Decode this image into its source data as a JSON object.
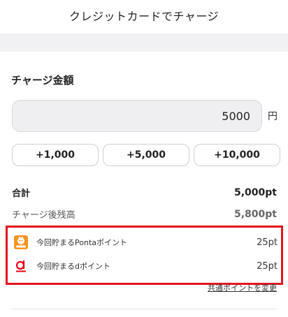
{
  "header": {
    "title": "クレジットカードでチャージ"
  },
  "charge": {
    "section_title": "チャージ金額",
    "amount_value": "5000",
    "unit": "円",
    "quick_buttons": [
      "+1,000",
      "+5,000",
      "+10,000"
    ]
  },
  "summary": {
    "total_label": "合計",
    "total_value": "5,000pt",
    "after_label": "チャージ後残高",
    "after_value": "5,800pt"
  },
  "points": [
    {
      "icon": "ponta-icon",
      "label": "今回貯まるPontaポイント",
      "value": "25pt"
    },
    {
      "icon": "d-point-icon",
      "label": "今回貯まるdポイント",
      "value": "25pt"
    }
  ],
  "links": {
    "change_points": "共通ポイントを変更"
  },
  "colors": {
    "highlight": "#e4141f",
    "ponta": "#f7931e",
    "dpoint": "#e60012"
  }
}
